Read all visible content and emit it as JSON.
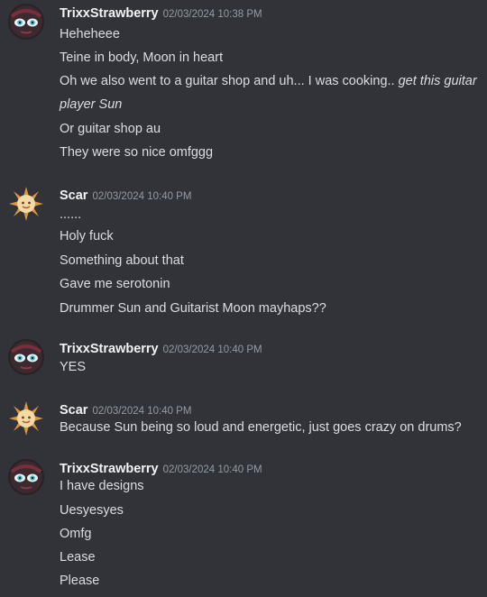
{
  "messages": [
    {
      "author": "TrixxStrawberry",
      "timestamp": "02/03/2024 10:38 PM",
      "avatar": "trixx-avatar-icon",
      "lines": [
        "Heheheee",
        "Teine in body, Moon in heart",
        {
          "plain": "Oh we also went to a guitar shop and uh... I was cooking.. ",
          "italic": "get this guitar player Sun"
        },
        "Or guitar shop au",
        "They were so nice omfggg"
      ]
    },
    {
      "author": "Scar",
      "timestamp": "02/03/2024 10:40 PM",
      "avatar": "sun-avatar-icon",
      "lines": [
        "......",
        "Holy fuck",
        "Something about that",
        "Gave me serotonin",
        "Drummer Sun and Guitarist Moon mayhaps??"
      ]
    },
    {
      "author": "TrixxStrawberry",
      "timestamp": "02/03/2024 10:40 PM",
      "avatar": "trixx-avatar-icon",
      "lines": [
        "YES"
      ]
    },
    {
      "author": "Scar",
      "timestamp": "02/03/2024 10:40 PM",
      "avatar": "sun-avatar-icon",
      "lines": [
        "Because Sun being so loud and energetic, just goes crazy on drums?"
      ]
    },
    {
      "author": "TrixxStrawberry",
      "timestamp": "02/03/2024 10:40 PM",
      "avatar": "trixx-avatar-icon",
      "lines": [
        "I have designs",
        "Uesyesyes",
        "Omfg",
        "Lease",
        "Please"
      ]
    }
  ],
  "colors": {
    "background": "#313338",
    "username": "#f2f3f5",
    "timestamp": "#949ba4",
    "text": "#dbdee1"
  }
}
